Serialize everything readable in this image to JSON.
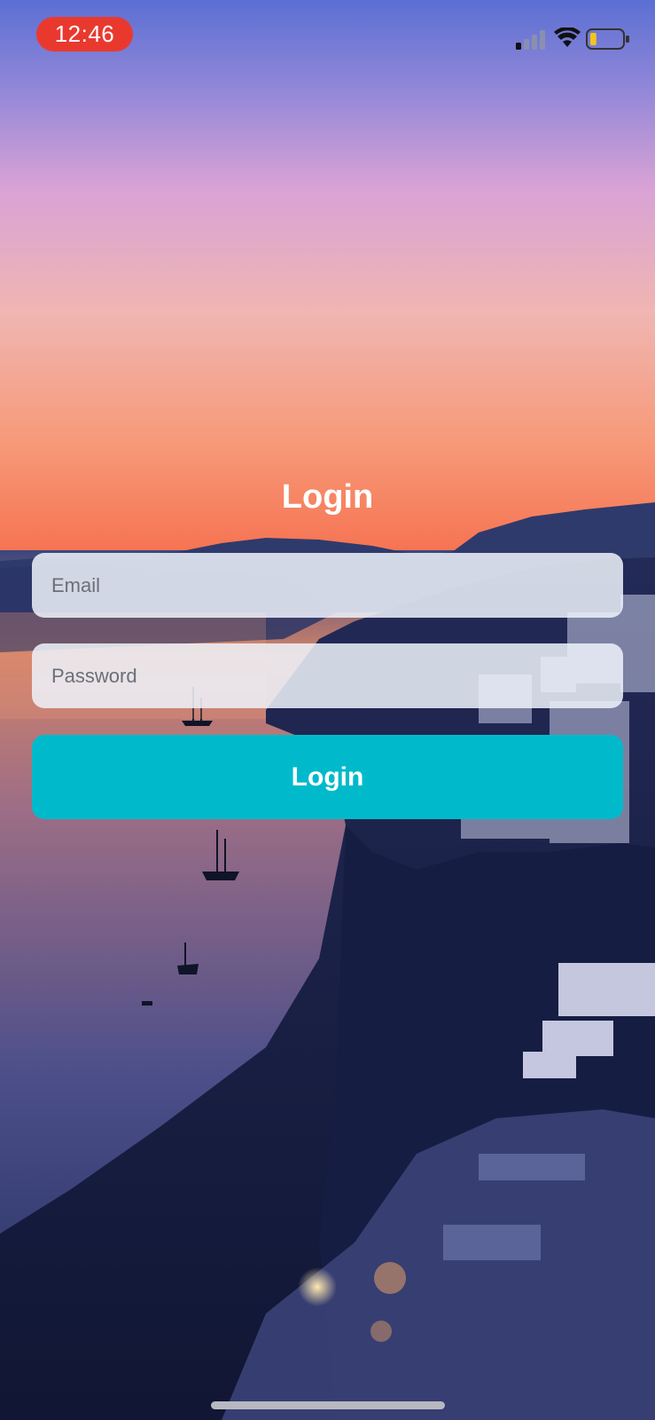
{
  "status_bar": {
    "time": "12:46",
    "time_pill_color": "#e9392f",
    "signal_icon": "cellular-signal-icon",
    "wifi_icon": "wifi-icon",
    "battery_icon": "battery-low-icon",
    "battery_level": 0.2,
    "battery_fill_color": "#f5c518"
  },
  "login": {
    "title": "Login",
    "email": {
      "placeholder": "Email",
      "value": ""
    },
    "password": {
      "placeholder": "Password",
      "value": ""
    },
    "submit_label": "Login",
    "button_color": "#00bacb"
  },
  "background": {
    "description_icon": "sunset-coastline-photo"
  }
}
